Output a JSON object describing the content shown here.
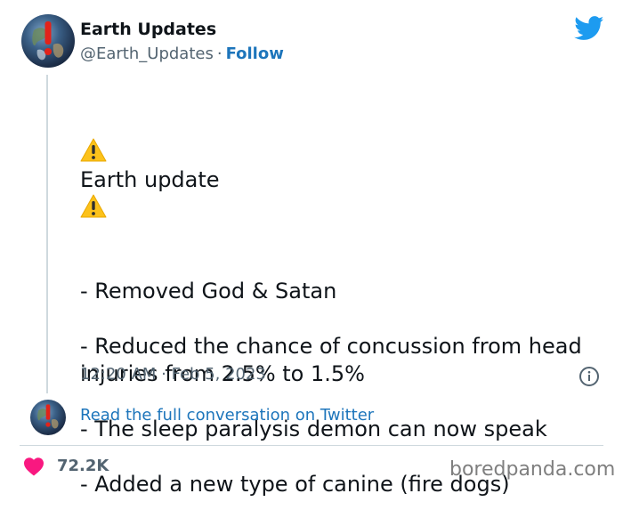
{
  "author": {
    "name": "Earth Updates",
    "handle": "@Earth_Updates",
    "separator": "·",
    "follow_label": "Follow"
  },
  "tweet": {
    "line1": "Earth update",
    "body": "- Removed God & Satan\n\n- Reduced the chance of concussion from head injuries from 2.5% to 1.5%\n\n- The sleep paralysis demon can now speak\n\n- Added a new type of canine (fire dogs)",
    "timestamp": "12:20 AM · Feb 5, 2023"
  },
  "conversation_link": "Read the full conversation on Twitter",
  "likes": "72.2K",
  "watermark": "boredpanda.com",
  "colors": {
    "link": "#1d75bb",
    "twitter_blue": "#1d9bf0",
    "heart": "#f91880",
    "warning_yellow": "#fcc21b",
    "muted": "#536471"
  },
  "icons": [
    "twitter-bird-icon",
    "warning-icon",
    "info-icon",
    "heart-icon"
  ]
}
